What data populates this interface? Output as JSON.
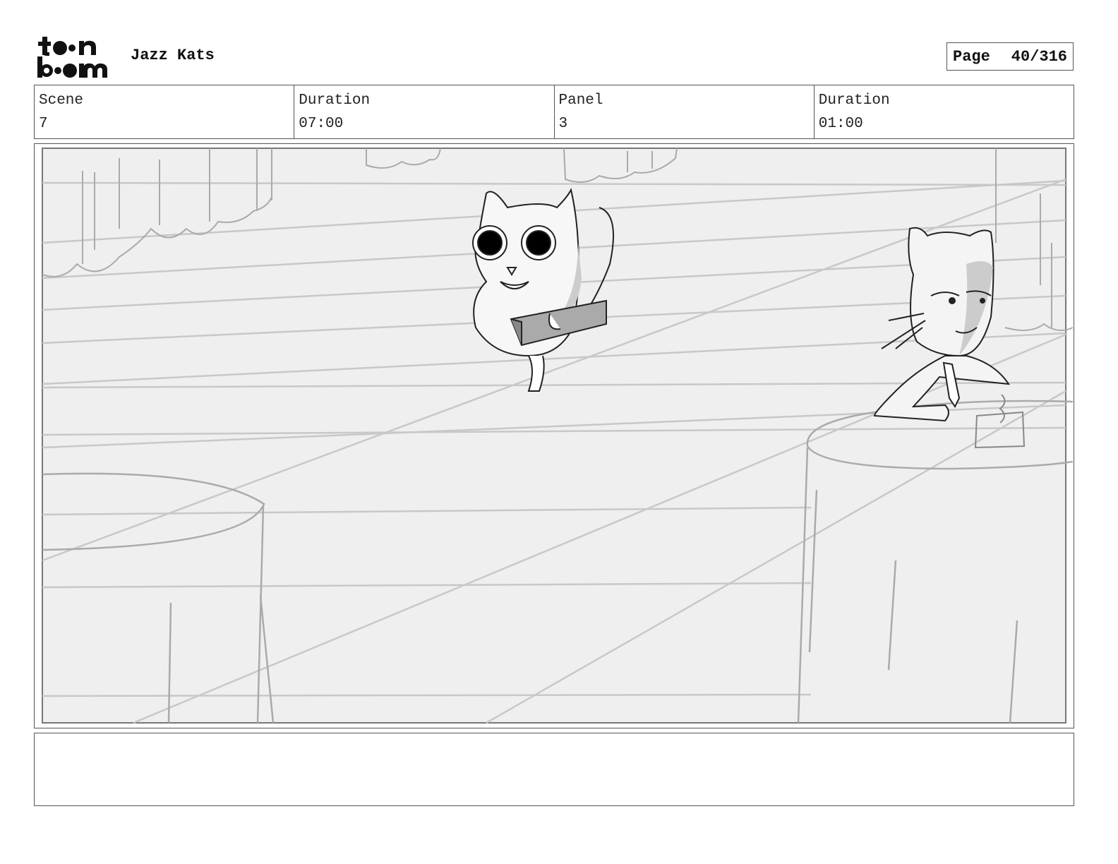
{
  "header": {
    "logo_name": "toon boom",
    "project_title": "Jazz Kats",
    "page_label": "Page",
    "page_number": "40/316"
  },
  "info": {
    "scene_label": "Scene",
    "scene_value": "7",
    "scene_duration_label": "Duration",
    "scene_duration_value": "07:00",
    "panel_label": "Panel",
    "panel_value": "3",
    "panel_duration_label": "Duration",
    "panel_duration_value": "01:00"
  },
  "notes": {
    "text": ""
  },
  "colors": {
    "border": "#555555",
    "panel_bg": "#efefef",
    "sketch_line": "#bbbbbb"
  }
}
